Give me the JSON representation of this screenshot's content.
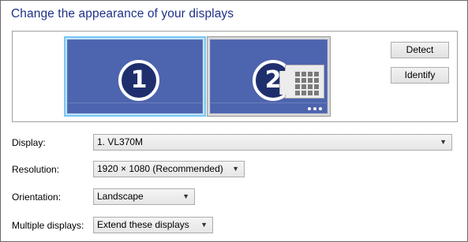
{
  "title": "Change the appearance of your displays",
  "monitors": [
    {
      "number": "1",
      "selected": true
    },
    {
      "number": "2",
      "selected": false
    }
  ],
  "buttons": {
    "detect": "Detect",
    "identify": "Identify"
  },
  "fields": {
    "display": {
      "label": "Display:",
      "value": "1. VL370M"
    },
    "resolution": {
      "label": "Resolution:",
      "value": "1920 × 1080 (Recommended)"
    },
    "orientation": {
      "label": "Orientation:",
      "value": "Landscape"
    },
    "multiple": {
      "label": "Multiple displays:",
      "value": "Extend these displays"
    }
  },
  "icons": {
    "dropdown": "chevron-down-icon",
    "start_screen": "start-screen-icon"
  },
  "colors": {
    "title": "#1e3287",
    "monitor_fill": "#4d64ae",
    "selected_border": "#7ac7f2"
  }
}
